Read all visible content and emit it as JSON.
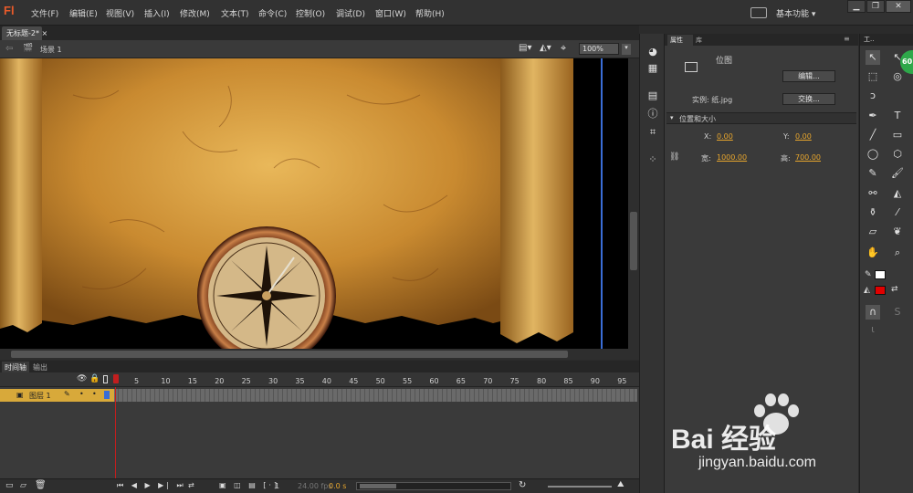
{
  "app": {
    "logo": "Fl",
    "workspace": "基本功能"
  },
  "menu": [
    "文件(F)",
    "编辑(E)",
    "视图(V)",
    "插入(I)",
    "修改(M)",
    "文本(T)",
    "命令(C)",
    "控制(O)",
    "调试(D)",
    "窗口(W)",
    "帮助(H)"
  ],
  "document": {
    "tab": "无标题-2*",
    "scene": "场景 1",
    "zoom": "100%"
  },
  "timeline": {
    "tabs": [
      "时间轴",
      "输出"
    ],
    "ticks": [
      "1",
      "5",
      "10",
      "15",
      "20",
      "25",
      "30",
      "35",
      "40",
      "45",
      "50",
      "55",
      "60",
      "65",
      "70",
      "75",
      "80",
      "85",
      "90",
      "95"
    ],
    "layer_name": "图层 1",
    "current_frame": "1",
    "fps": "24.00 fps",
    "time": "0.0 s"
  },
  "properties": {
    "tabs": [
      "属性",
      "库"
    ],
    "type": "位图",
    "edit_button": "编辑...",
    "instance_label": "实例: 纸.jpg",
    "swap_button": "交换...",
    "section": "位置和大小",
    "x_label": "X:",
    "x_value": "0.00",
    "y_label": "Y:",
    "y_value": "0.00",
    "w_label": "宽:",
    "w_value": "1000.00",
    "h_label": "高:",
    "h_value": "700.00"
  },
  "tools_panel": {
    "title": "工.."
  },
  "badge": {
    "value": "60"
  },
  "watermark": {
    "brand": "Bai 经验",
    "url": "jingyan.baidu.com"
  },
  "colors": {
    "accent": "#e8a62d",
    "fill_color": "#e00000",
    "stroke_color": "#ffffff",
    "layer_bar": "#d8a93a",
    "playhead": "#c21e1e"
  }
}
